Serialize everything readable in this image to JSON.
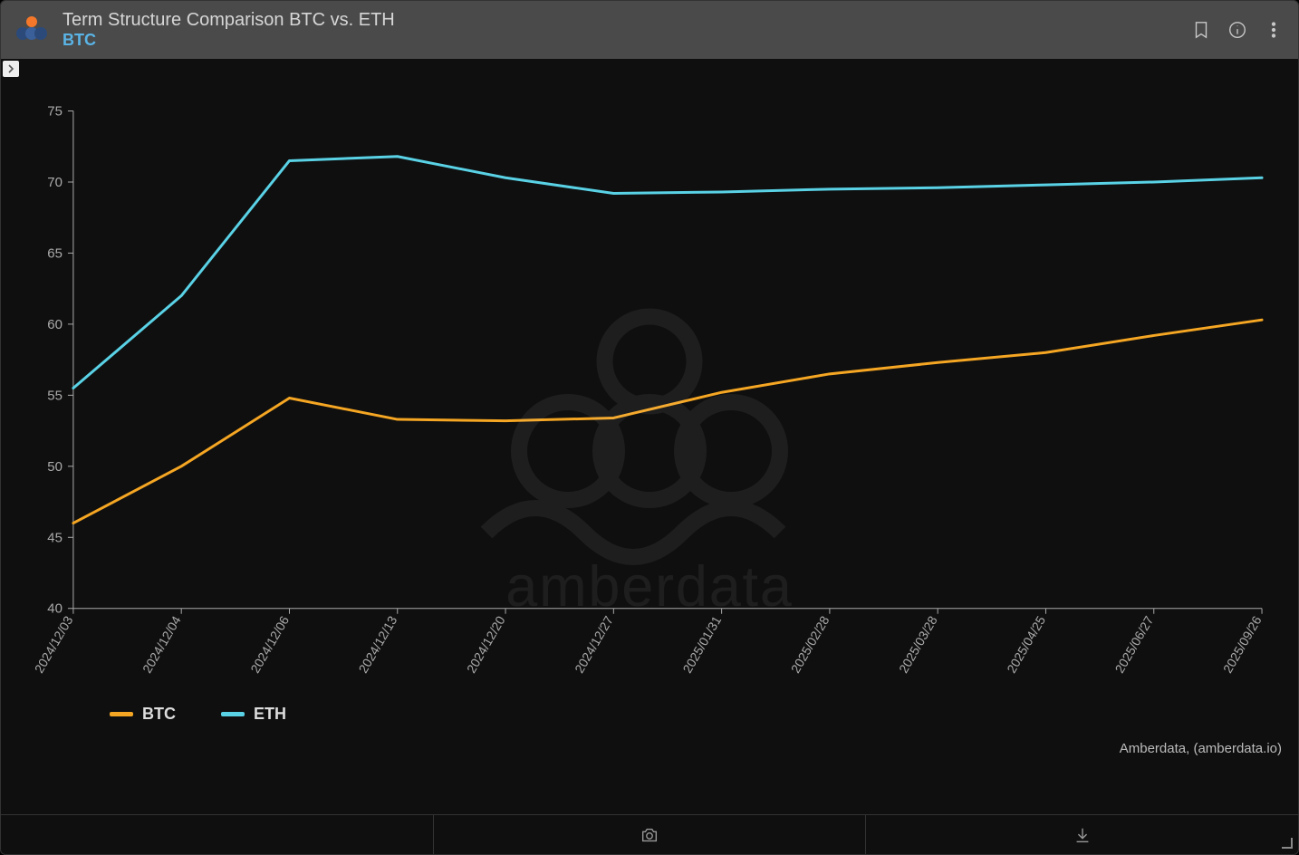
{
  "header": {
    "title": "Term Structure Comparison BTC vs. ETH",
    "subtitle": "BTC"
  },
  "chart_data": {
    "type": "line",
    "title": "Term Structure Comparison BTC vs. ETH",
    "xlabel": "",
    "ylabel": "",
    "ylim": [
      40,
      75
    ],
    "x_ticks": [
      "2024/12/03",
      "2024/12/04",
      "2024/12/06",
      "2024/12/13",
      "2024/12/20",
      "2024/12/27",
      "2025/01/31",
      "2025/02/28",
      "2025/03/28",
      "2025/04/25",
      "2025/06/27",
      "2025/09/26"
    ],
    "categories": [
      "2024/12/03",
      "2024/12/04",
      "2024/12/06",
      "2024/12/13",
      "2024/12/20",
      "2024/12/27",
      "2025/01/31",
      "2025/02/28",
      "2025/03/28",
      "2025/04/25",
      "2025/06/27",
      "2025/09/26"
    ],
    "series": [
      {
        "name": "BTC",
        "color": "#f5a623",
        "values": [
          46.0,
          50.0,
          54.8,
          53.3,
          53.2,
          53.4,
          55.2,
          56.5,
          57.3,
          58.0,
          59.2,
          60.3
        ]
      },
      {
        "name": "ETH",
        "color": "#5ad2e6",
        "values": [
          55.5,
          62.0,
          71.5,
          71.8,
          70.3,
          69.2,
          69.3,
          69.5,
          69.6,
          69.8,
          70.0,
          70.3
        ]
      }
    ],
    "y_ticks": [
      40,
      45,
      50,
      55,
      60,
      65,
      70,
      75
    ]
  },
  "legend": {
    "items": [
      {
        "label": "BTC",
        "color": "#f5a623"
      },
      {
        "label": "ETH",
        "color": "#5ad2e6"
      }
    ]
  },
  "attribution": "Amberdata, (amberdata.io)",
  "watermark": "amberdata"
}
